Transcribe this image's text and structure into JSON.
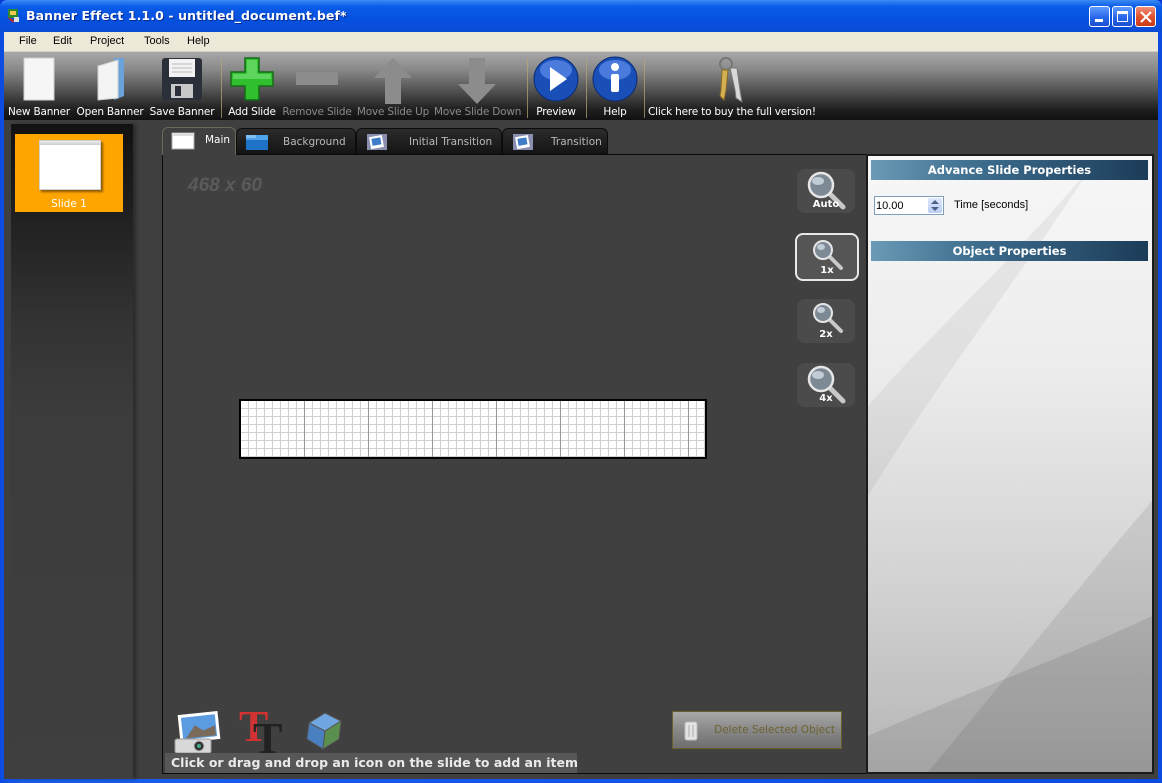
{
  "window": {
    "title": "Banner Effect 1.1.0 -  untitled_document.bef*",
    "controls": [
      "minimize",
      "maximize",
      "close"
    ]
  },
  "menubar": {
    "items": [
      {
        "label": "File"
      },
      {
        "label": "Edit"
      },
      {
        "label": "Project"
      },
      {
        "label": "Tools"
      },
      {
        "label": "Help"
      }
    ]
  },
  "toolbar": {
    "buttons": [
      {
        "label": "New Banner",
        "icon": "new-document-icon",
        "enabled": true
      },
      {
        "label": "Open Banner",
        "icon": "open-folder-icon",
        "enabled": true
      },
      {
        "label": "Save Banner",
        "icon": "floppy-disk-icon",
        "enabled": true
      },
      {
        "label": "Add Slide",
        "icon": "plus-icon",
        "enabled": true
      },
      {
        "label": "Remove Slide",
        "icon": "minus-icon",
        "enabled": false
      },
      {
        "label": "Move Slide Up",
        "icon": "arrow-up-icon",
        "enabled": false
      },
      {
        "label": "Move Slide Down",
        "icon": "arrow-down-icon",
        "enabled": false
      },
      {
        "label": "Preview",
        "icon": "play-icon",
        "enabled": true
      },
      {
        "label": "Help",
        "icon": "info-icon",
        "enabled": true
      },
      {
        "label": "Click here to buy the full version!",
        "icon": "keys-icon",
        "enabled": true
      }
    ]
  },
  "slides": {
    "items": [
      {
        "label": "Slide 1",
        "selected": true
      }
    ],
    "selected_color": "#FFA500"
  },
  "tabs": [
    {
      "label": "Main",
      "active": true,
      "icon": "window-icon"
    },
    {
      "label": "Background",
      "icon": "background-icon"
    },
    {
      "label": "Initial Transition",
      "icon": "transition-icon"
    },
    {
      "label": "Transition",
      "icon": "transition-icon"
    }
  ],
  "editor": {
    "banner_size": "468 x 60",
    "zoom_buttons": [
      {
        "label": "Auto",
        "active": false
      },
      {
        "label": "1x",
        "active": true
      },
      {
        "label": "2x",
        "active": false
      },
      {
        "label": "4x",
        "active": false
      }
    ],
    "add_tools": [
      {
        "name": "image",
        "icon": "photo-camera-icon"
      },
      {
        "name": "text",
        "icon": "text-icon"
      },
      {
        "name": "3d-object",
        "icon": "cube-icon"
      }
    ],
    "hint": "Click or drag and drop an icon on the slide to add an item",
    "delete_button": "Delete Selected Object"
  },
  "properties": {
    "advance_header": "Advance Slide Properties",
    "time_value": "10.00",
    "time_label": "Time [seconds]",
    "object_header": "Object Properties"
  }
}
